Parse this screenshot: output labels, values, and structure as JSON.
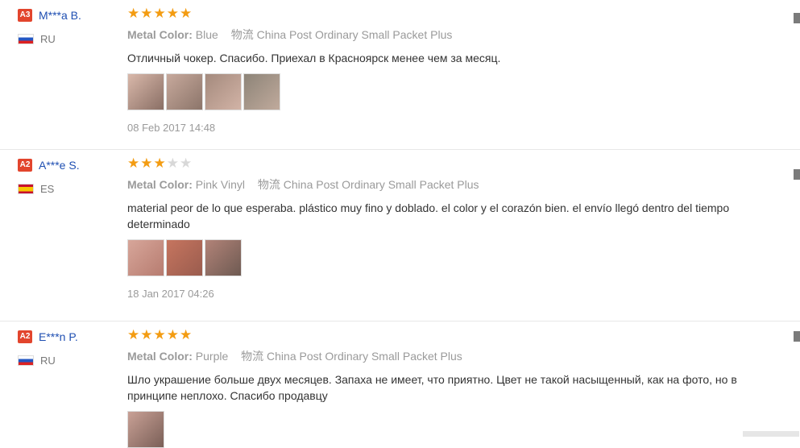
{
  "reviews": [
    {
      "badge": "A3",
      "user": "M***a B.",
      "country": "RU",
      "flag": "ru",
      "stars": 5,
      "metal_label": "Metal Color:",
      "metal_value": "Blue",
      "shipping": "物流 China Post Ordinary Small Packet Plus",
      "text": "Отличный чокер. Спасибо. Приехал в Красноярск менее чем за месяц.",
      "photos": 4,
      "photo_colors": [
        "#c5a397",
        "#b89a8f",
        "#a48b7d",
        "#9a8d80"
      ],
      "date": "08 Feb 2017 14:48"
    },
    {
      "badge": "A2",
      "user": "A***e S.",
      "country": "ES",
      "flag": "es",
      "stars": 3,
      "metal_label": "Metal Color:",
      "metal_value": "Pink Vinyl",
      "shipping": "物流 China Post Ordinary Small Packet Plus",
      "text": "material peor de lo que esperaba. plástico muy fino y doblado. el color y el corazón bien. el envío llegó dentro del tiempo determinado",
      "photos": 3,
      "photo_colors": [
        "#c98f84",
        "#b86b5a",
        "#9a7266"
      ],
      "date": "18 Jan 2017 04:26"
    },
    {
      "badge": "A2",
      "user": "E***n P.",
      "country": "RU",
      "flag": "ru",
      "stars": 5,
      "metal_label": "Metal Color:",
      "metal_value": "Purple",
      "shipping": "物流 China Post Ordinary Small Packet Plus",
      "text": "Шло украшение больше двух месяцев. Запаха не имеет, что приятно. Цвет не такой насыщенный, как на фото, но в принципе неплохо. Спасибо продавцу",
      "photos": 1,
      "photo_colors": [
        "#b09088"
      ],
      "date": ""
    }
  ]
}
